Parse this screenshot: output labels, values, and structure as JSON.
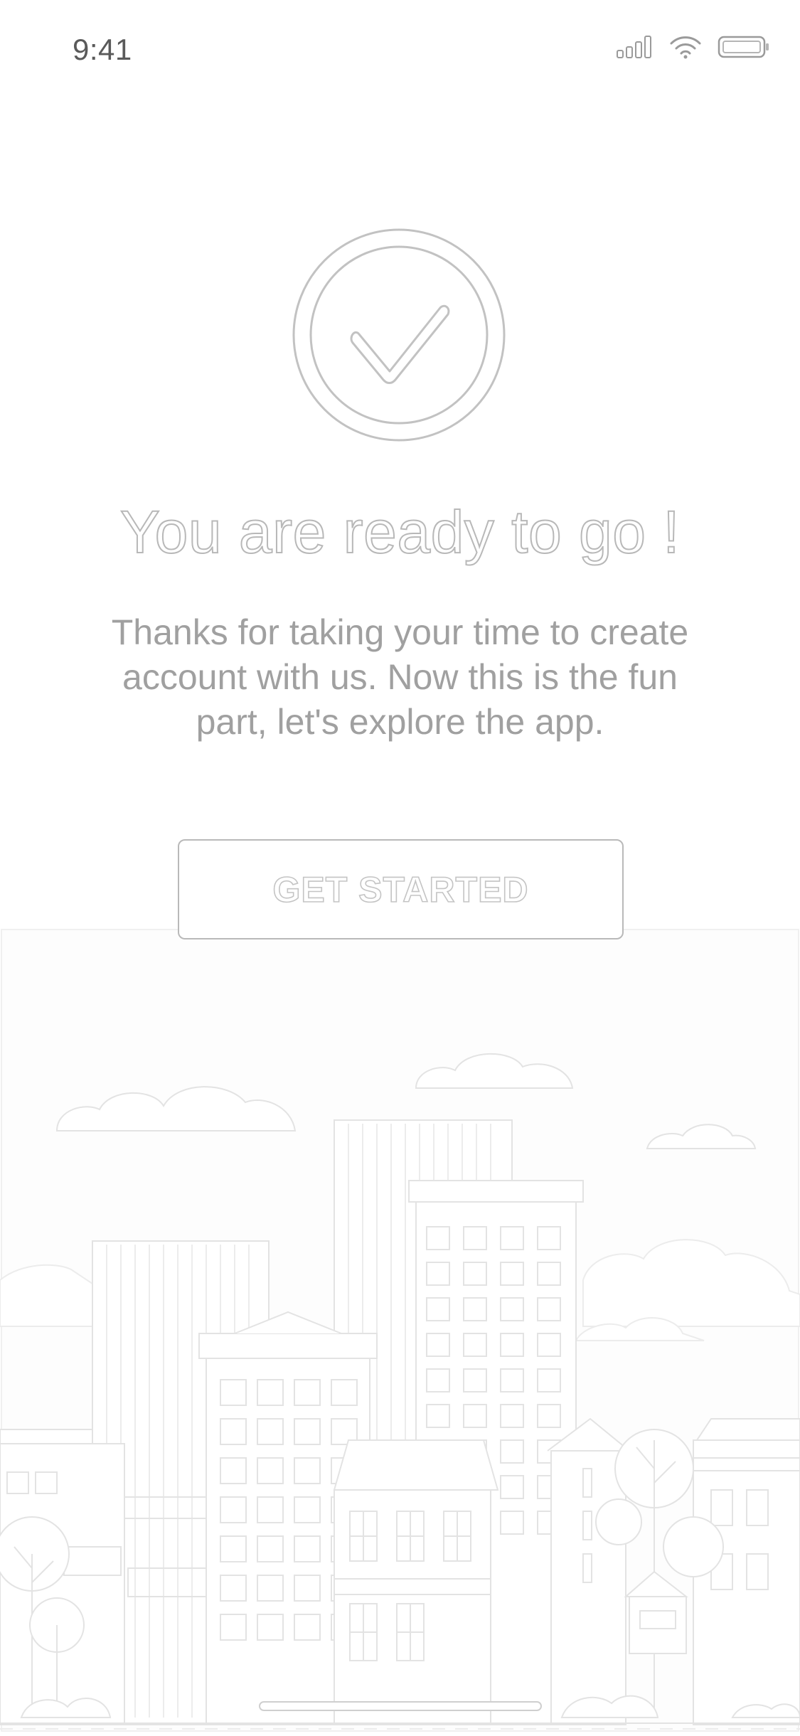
{
  "status_bar": {
    "time": "9:41",
    "icons": [
      "signal-icon",
      "wifi-icon",
      "battery-icon"
    ]
  },
  "hero": {
    "icon": "checkmark-circle-icon",
    "title": "You are ready to go !",
    "body_lines": [
      "Thanks for taking your time to create",
      "account with us. Now this is the fun",
      "part, let's explore the app."
    ]
  },
  "cta": {
    "label": "GET STARTED"
  },
  "illustration": {
    "icon": "city-skyline-illustration"
  },
  "colors": {
    "background": "#ffffff",
    "stroke": "#b8b8b8",
    "text": "#a0a0a0",
    "illustration_stroke": "#e3e3e3"
  }
}
